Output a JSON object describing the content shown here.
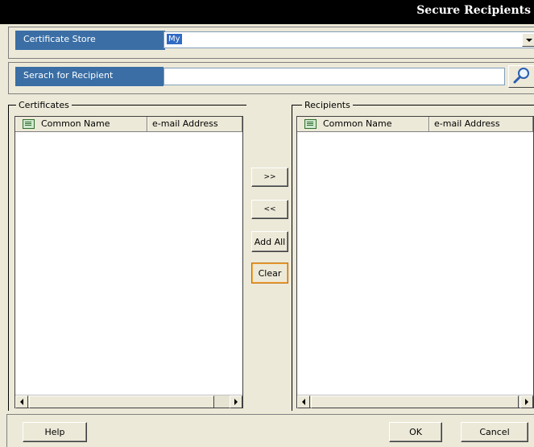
{
  "window": {
    "title": "Secure Recipients"
  },
  "certificate_store": {
    "label": "Certificate Store",
    "value": "My"
  },
  "search": {
    "label": "Serach for Recipient",
    "value": ""
  },
  "certificates": {
    "legend": "Certificates",
    "columns": [
      "Common Name",
      "e-mail Address"
    ]
  },
  "recipients": {
    "legend": "Recipients",
    "columns": [
      "Common Name",
      "e-mail Address"
    ]
  },
  "transfer_buttons": {
    "add": ">>",
    "remove": "<<",
    "add_all": "Add All",
    "clear": "Clear"
  },
  "footer": {
    "help": "Help",
    "ok": "OK",
    "cancel": "Cancel"
  },
  "colors": {
    "title_bar": "#000000",
    "label_background": "#3a6ea5",
    "dialog_background": "#ece9d8",
    "focus_border": "#c46a00"
  },
  "icons": {
    "search": "magnifier-icon",
    "column_header": "list-column-icon"
  }
}
